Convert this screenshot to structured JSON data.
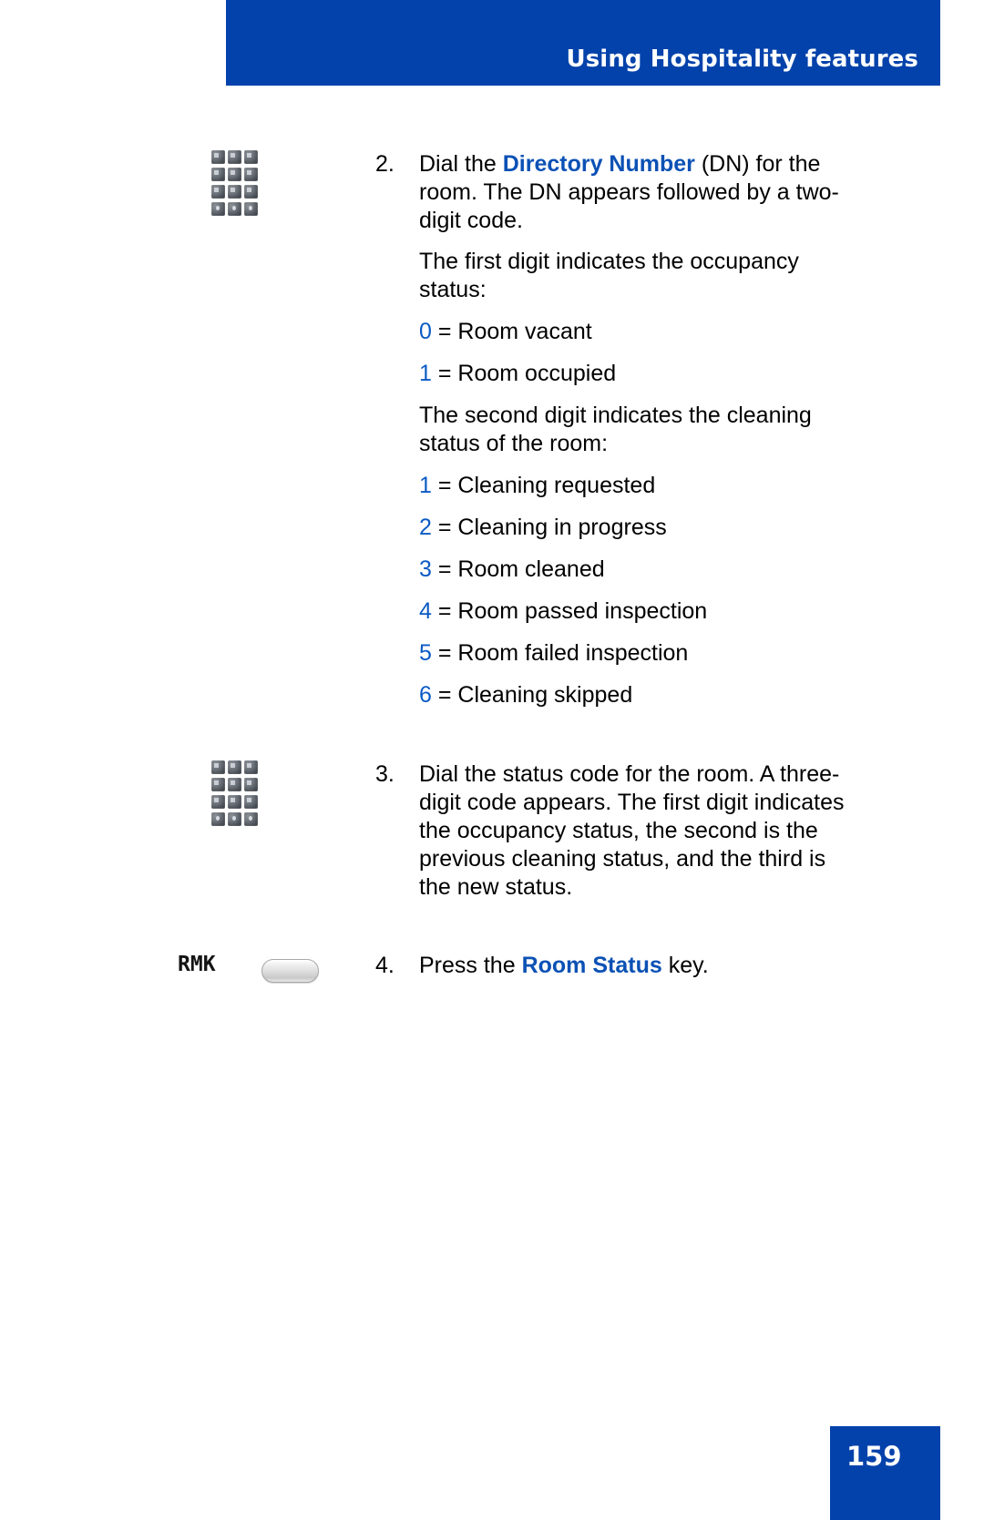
{
  "header": {
    "title": "Using Hospitality features",
    "background_color": "#0442ab",
    "text_color": "#ffffff"
  },
  "colors": {
    "accent_blue": "#0442ab",
    "link_blue": "#0b51b5",
    "code_blue": "#0b5ac4",
    "body_text": "#000000"
  },
  "steps": [
    {
      "number": "2.",
      "icon": "keypad-icon",
      "text_parts": [
        {
          "text": "Dial the ",
          "style": "normal"
        },
        {
          "text": "Directory Number",
          "style": "blue-bold"
        },
        {
          "text": " (DN) for the room. The DN appears followed by a two-digit code.",
          "style": "normal"
        }
      ],
      "plain_text": "Dial the Directory Number (DN) for the room. The DN appears followed by a two-digit code."
    },
    {
      "number": "3.",
      "icon": "keypad-icon",
      "text_parts": [
        {
          "text": "Dial the status code for the room. A three-digit code appears. The first digit indicates the occupancy status, the second is the previous cleaning status, and the third is the new status.",
          "style": "normal"
        }
      ],
      "plain_text": "Dial the status code for the room. A three-digit code appears. The first digit indicates the occupancy status, the second is the previous cleaning status, and the third is the new status."
    },
    {
      "number": "4.",
      "icon": "softkey-rmk",
      "icon_label": "RMK",
      "text_parts": [
        {
          "text": "Press the ",
          "style": "normal"
        },
        {
          "text": "Room Status",
          "style": "blue-bold"
        },
        {
          "text": " key.",
          "style": "normal"
        }
      ],
      "plain_text": "Press the Room Status key."
    }
  ],
  "paragraphs": {
    "occupancy_intro": "The first digit indicates the occupancy status:",
    "cleaning_intro": "The second digit indicates the cleaning status of the room:"
  },
  "occupancy_codes": [
    {
      "code": "0",
      "equals": "=",
      "label": "Room vacant"
    },
    {
      "code": "1",
      "equals": "=",
      "label": "Room occupied"
    }
  ],
  "cleaning_codes": [
    {
      "code": "1",
      "equals": "=",
      "label": "Cleaning requested"
    },
    {
      "code": "2",
      "equals": "=",
      "label": "Cleaning in progress"
    },
    {
      "code": "3",
      "equals": "=",
      "label": "Room cleaned"
    },
    {
      "code": "4",
      "equals": "=",
      "label": "Room passed inspection"
    },
    {
      "code": "5",
      "equals": "=",
      "label": "Room failed inspection"
    },
    {
      "code": "6",
      "equals": "=",
      "label": "Cleaning skipped"
    }
  ],
  "footer": {
    "page_number": "159"
  }
}
